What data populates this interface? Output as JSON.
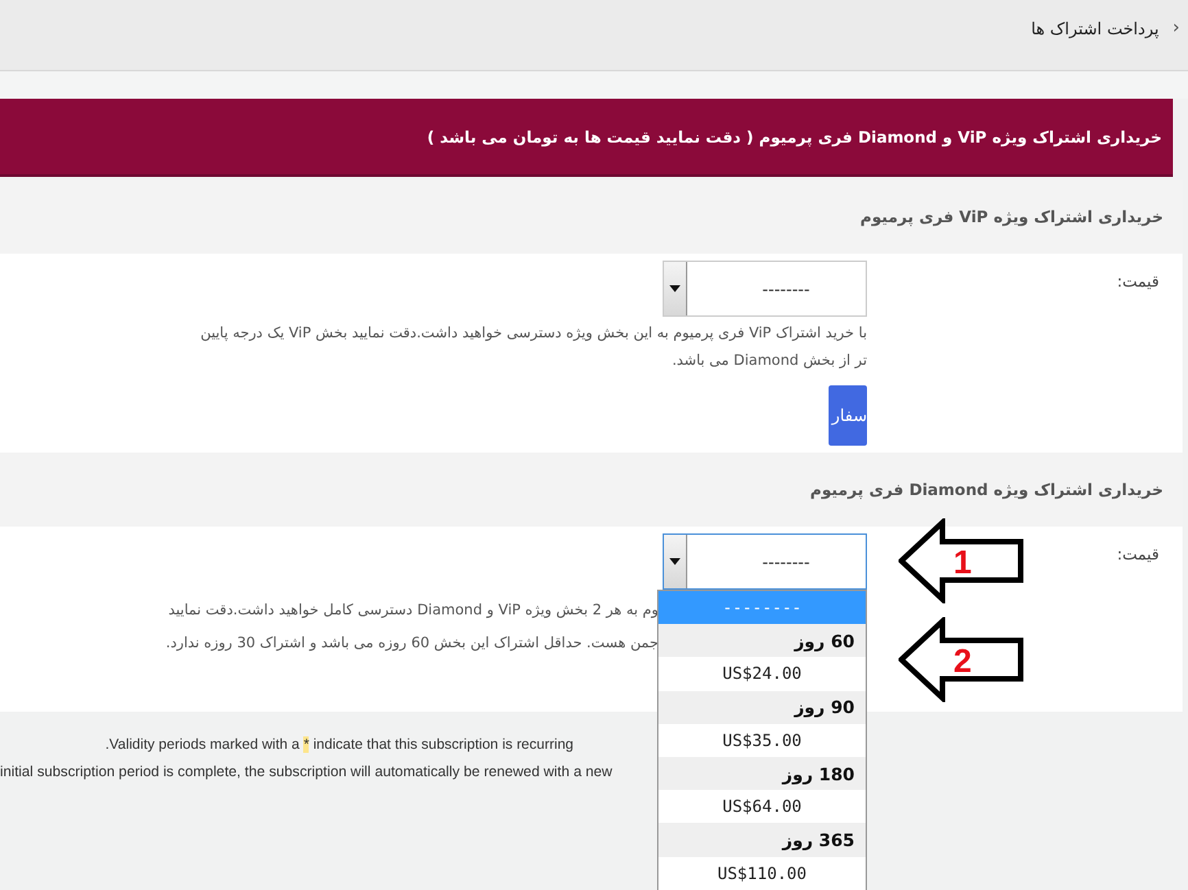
{
  "breadcrumb": {
    "chevron": "‹",
    "title": "پرداخت اشتراک ها"
  },
  "banner": {
    "text": "خریداری اشتراک ویژه ViP و Diamond فری پرمیوم ( دقت نمایید قیمت ها به تومان می باشد )"
  },
  "panels": [
    {
      "title": "خریداری اشتراک ویژه ViP فری پرمیوم",
      "price_label": "قیمت:",
      "select": {
        "value": "--------",
        "focused": false
      },
      "description": "با خرید اشتراک ViP فری پرمیوم به این بخش ویژه دسترسی خواهید داشت.دقت نمایید بخش ViP یک درجه پایین تر از بخش Diamond می باشد.",
      "button": "سفار"
    },
    {
      "title": "خریداری اشتراک ویژه Diamond فری پرمیوم",
      "price_label": "قیمت:",
      "select": {
        "value": "--------",
        "focused": true
      },
      "description_lines": [
        "وم به هر 2 بخش ویژه ViP و Diamond دسترسی کامل خواهید داشت.دقت نمایید",
        "جمن هست. حداقل اشتراک این بخش 60 روزه می باشد و اشتراک 30 روزه ندارد."
      ],
      "dropdown": [
        {
          "kind": "option",
          "label": "--------",
          "selected": true
        },
        {
          "kind": "group",
          "label": "60 روز"
        },
        {
          "kind": "option",
          "label": "US$24.00",
          "selected": false
        },
        {
          "kind": "group",
          "label": "90 روز"
        },
        {
          "kind": "option",
          "label": "US$35.00",
          "selected": false
        },
        {
          "kind": "group",
          "label": "180 روز"
        },
        {
          "kind": "option",
          "label": "US$64.00",
          "selected": false
        },
        {
          "kind": "group",
          "label": "365 روز"
        },
        {
          "kind": "option",
          "label": "US$110.00",
          "selected": false
        }
      ]
    }
  ],
  "annotations": [
    {
      "label": "1"
    },
    {
      "label": "2"
    }
  ],
  "footnote": {
    "before": ".Validity periods marked with a ",
    "mark": "*",
    "after": " indicate that this subscription is recurring",
    "line_2": "initial subscription period is complete, the subscription will automatically be renewed with a new"
  }
}
